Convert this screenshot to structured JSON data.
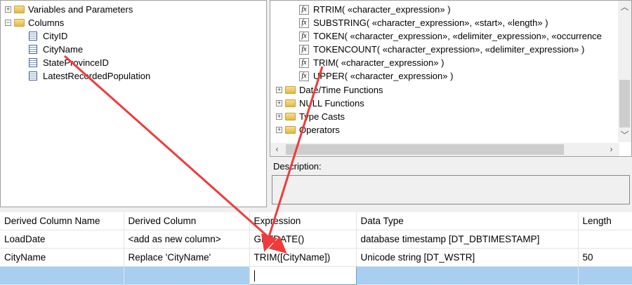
{
  "variables_tree": {
    "items": [
      {
        "label": "Variables and Parameters",
        "expander": "+"
      },
      {
        "label": "Columns",
        "expander": "−"
      }
    ],
    "columns": [
      "CityID",
      "CityName",
      "StateProvinceID",
      "LatestRecordedPopulation"
    ]
  },
  "functions_tree": {
    "functions": [
      "RTRIM( «character_expression» )",
      "SUBSTRING( «character_expression», «start», «length» )",
      "TOKEN( «character_expression», «delimiter_expression», «occurrence",
      "TOKENCOUNT( «character_expression», «delimiter_expression» )",
      "TRIM( «character_expression» )",
      "UPPER( «character_expression» )"
    ],
    "folders": [
      "Date/Time Functions",
      "NULL Functions",
      "Type Casts",
      "Operators"
    ],
    "fx_glyph": "fx",
    "expander": "+"
  },
  "description": {
    "label": "Description:"
  },
  "grid": {
    "headers": [
      "Derived Column Name",
      "Derived Column",
      "Expression",
      "Data Type",
      "Length"
    ],
    "rows": [
      [
        "LoadDate",
        "<add as new column>",
        "GETDATE()",
        "database timestamp [DT_DBTIMESTAMP]",
        ""
      ],
      [
        "CityName",
        "Replace 'CityName'",
        "TRIM([CityName])",
        "Unicode string [DT_WSTR]",
        "50"
      ]
    ]
  },
  "colors": {
    "annotation_arrow": "#ee3b3b",
    "selected_row": "#a9cff0"
  }
}
